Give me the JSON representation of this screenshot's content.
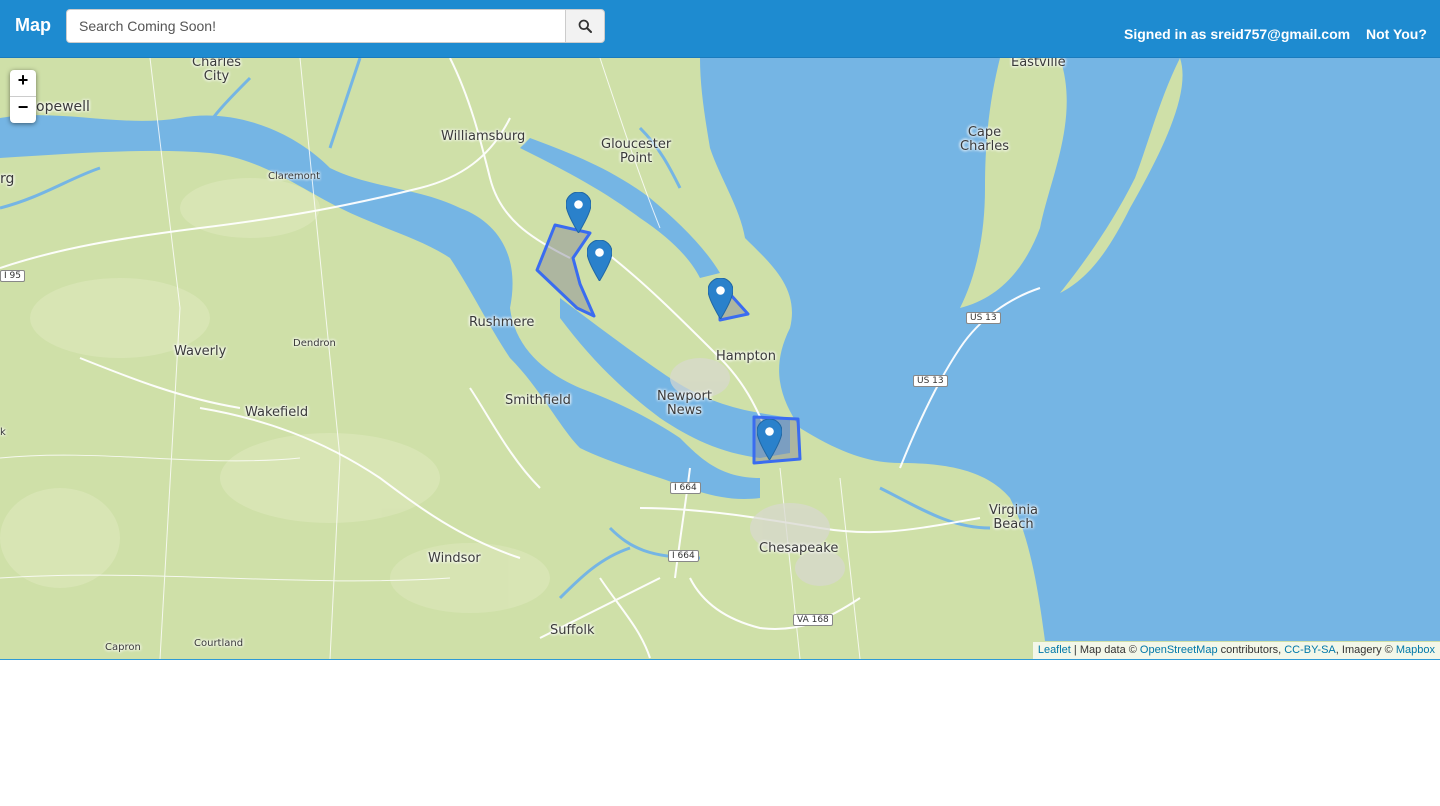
{
  "navbar": {
    "brand": "Map",
    "search_placeholder": "Search Coming Soon!",
    "signed_in_text": "Signed in as sreid757@gmail.com",
    "not_you_label": "Not You?"
  },
  "map": {
    "zoom_in_label": "+",
    "zoom_out_label": "−",
    "labels": {
      "charles_city": "Charles\nCity",
      "hopewell": "opewell",
      "williamsburg": "Williamsburg",
      "gloucester_point": "Gloucester\nPoint",
      "eastville": "Eastville",
      "cape_charles": "Cape\nCharles",
      "claremont": "Claremont",
      "rg": "rg",
      "rushmere": "Rushmere",
      "waverly": "Waverly",
      "dendron": "Dendron",
      "hampton": "Hampton",
      "newport_news": "Newport\nNews",
      "wakefield": "Wakefield",
      "smithfield": "Smithfield",
      "virginia_beach": "Virginia\nBeach",
      "chesapeake": "Chesapeake",
      "windsor": "Windsor",
      "suffolk": "Suffolk",
      "capron": "Capron",
      "courtland": "Courtland",
      "k": "k"
    },
    "shields": {
      "i95": "I 95",
      "us13a": "US 13",
      "us13b": "US 13",
      "i664a": "I 664",
      "i664b": "I 664",
      "va168": "VA 168"
    },
    "colors": {
      "water": "#75b5e4",
      "land": "#cfe0a8",
      "polygon_stroke": "#3a6cf0",
      "marker": "#2a81cb"
    }
  },
  "attribution": {
    "leaflet": "Leaflet",
    "sep1": " | Map data © ",
    "osm": "OpenStreetMap",
    "sep2": " contributors, ",
    "license": "CC-BY-SA",
    "sep3": ", Imagery © ",
    "mapbox": "Mapbox"
  }
}
